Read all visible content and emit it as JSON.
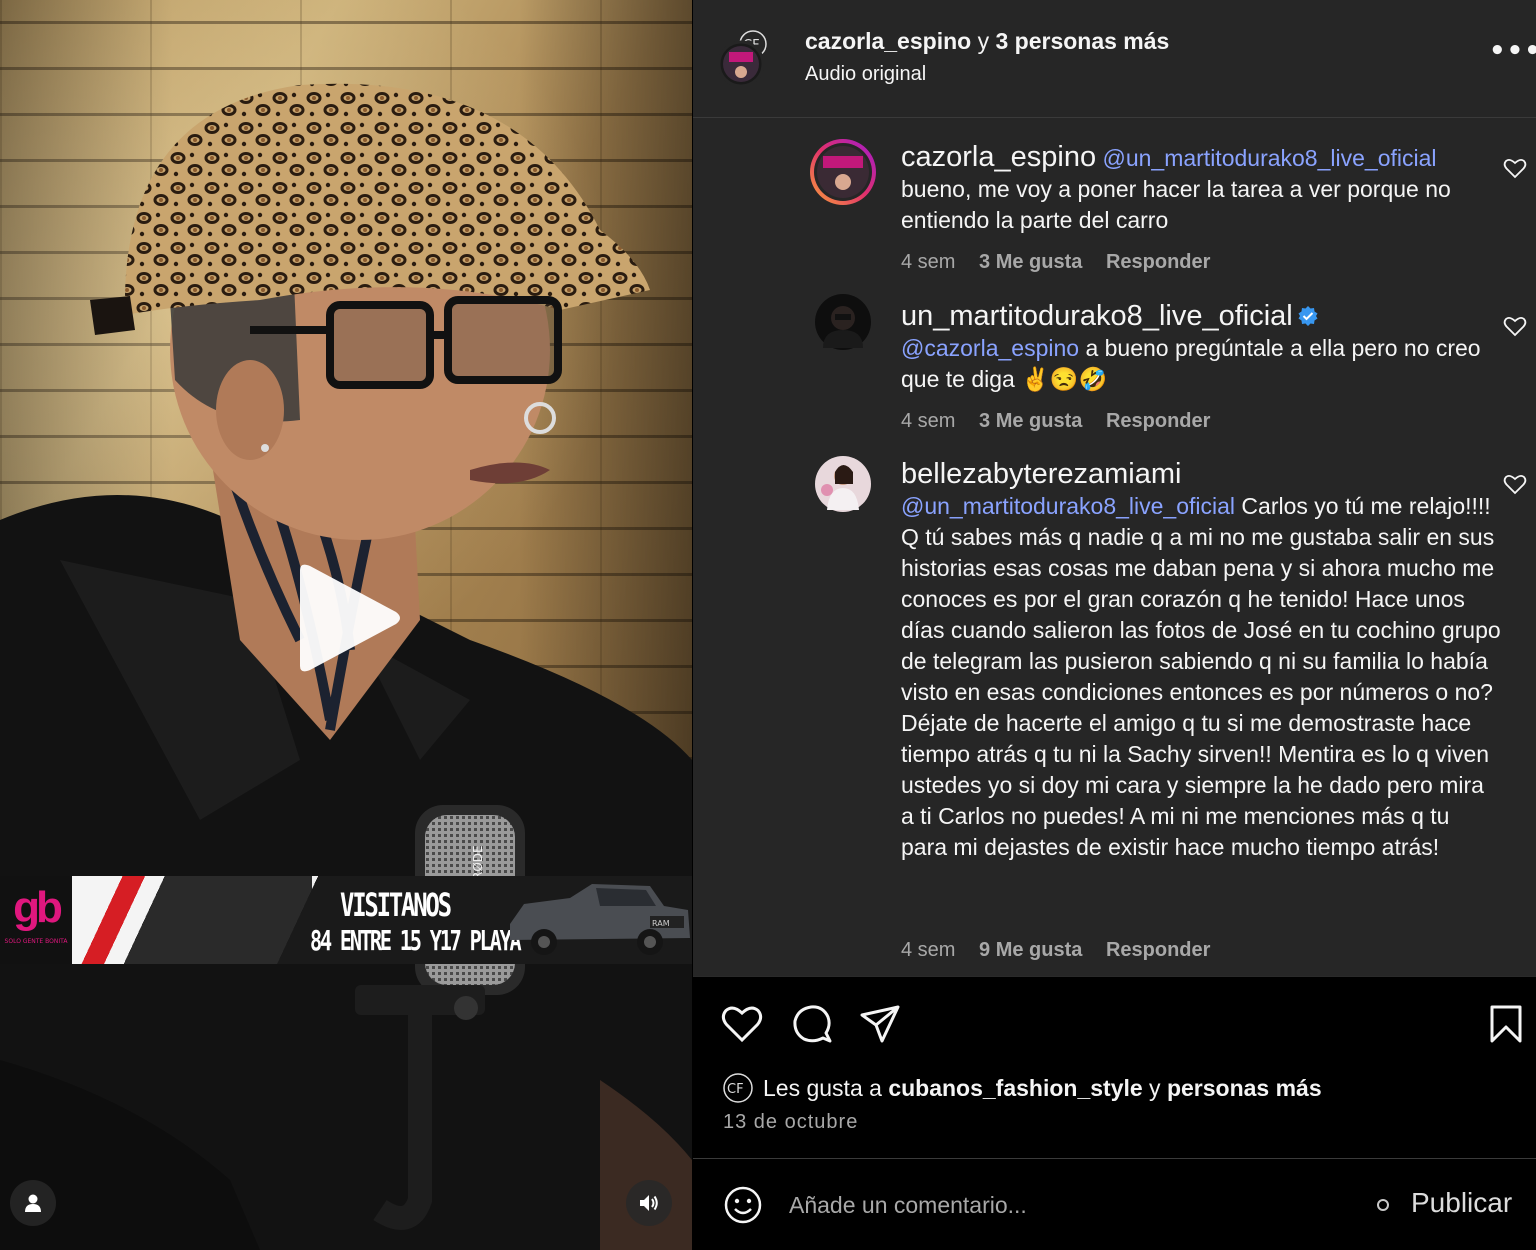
{
  "header": {
    "author": "cazorla_espino",
    "connector": " y ",
    "others": "3 personas más",
    "audio": "Audio original",
    "avatar_initials": "CF"
  },
  "video": {
    "banner_logo": "gb",
    "banner_logo_sub": "SOLO GENTE BONITA",
    "banner_line1": "VISITANOS",
    "banner_line2": "84 ENTRE 15 Y17 PLAYA",
    "mic_label": "RØDE",
    "truck_brand": "RAM"
  },
  "comments": [
    {
      "user": "cazorla_espino",
      "mention": "@un_martitodurako8_live_oficial",
      "text": "bueno, me voy a poner hacer la tarea a ver porque no entiendo la parte del carro",
      "time": "4 sem",
      "likes": "3 Me gusta",
      "reply": "Responder"
    },
    {
      "user": "un_martitodurako8_live_oficial",
      "mention": "@cazorla_espino",
      "text": "a bueno pregúntale a ella pero no creo que te diga ✌️😒🤣",
      "time": "4 sem",
      "likes": "3 Me gusta",
      "reply": "Responder"
    },
    {
      "user": "bellezabyterezamiami",
      "mention": "@un_martitodurako8_live_oficial",
      "text": "Carlos yo tú me relajo!!!! Q tú sabes más q nadie q a mi no me gustaba salir en sus historias esas cosas me daban pena y si ahora mucho me conoces es por el gran corazón q he tenido! Hace unos días cuando salieron las fotos de José en tu cochino grupo de telegram las pusieron sabiendo q ni su familia lo había visto en esas condiciones entonces es por números o no? Déjate de hacerte el amigo q tu si me demostraste hace tiempo atrás q tu ni la Sachy sirven!! Mentira es lo q viven ustedes yo si doy mi cara y siempre la he dado pero mira a ti Carlos no puedes! A mi ni me menciones más q tu para mi dejastes de existir hace mucho tiempo atrás!",
      "time": "4 sem",
      "likes": "9 Me gusta",
      "reply": "Responder"
    }
  ],
  "likes_line": {
    "prefix": "Les gusta a ",
    "user": "cubanos_fashion_style",
    "connector": " y ",
    "rest": "personas más",
    "avatar_initials": "CF"
  },
  "date": "13 de octubre",
  "composer": {
    "placeholder": "Añade un comentario...",
    "publish": "Publicar"
  },
  "colors": {
    "mention": "#8aa3ff",
    "verified": "#3897f0",
    "panel_bg": "#262626",
    "muted": "#a8a8a8"
  }
}
